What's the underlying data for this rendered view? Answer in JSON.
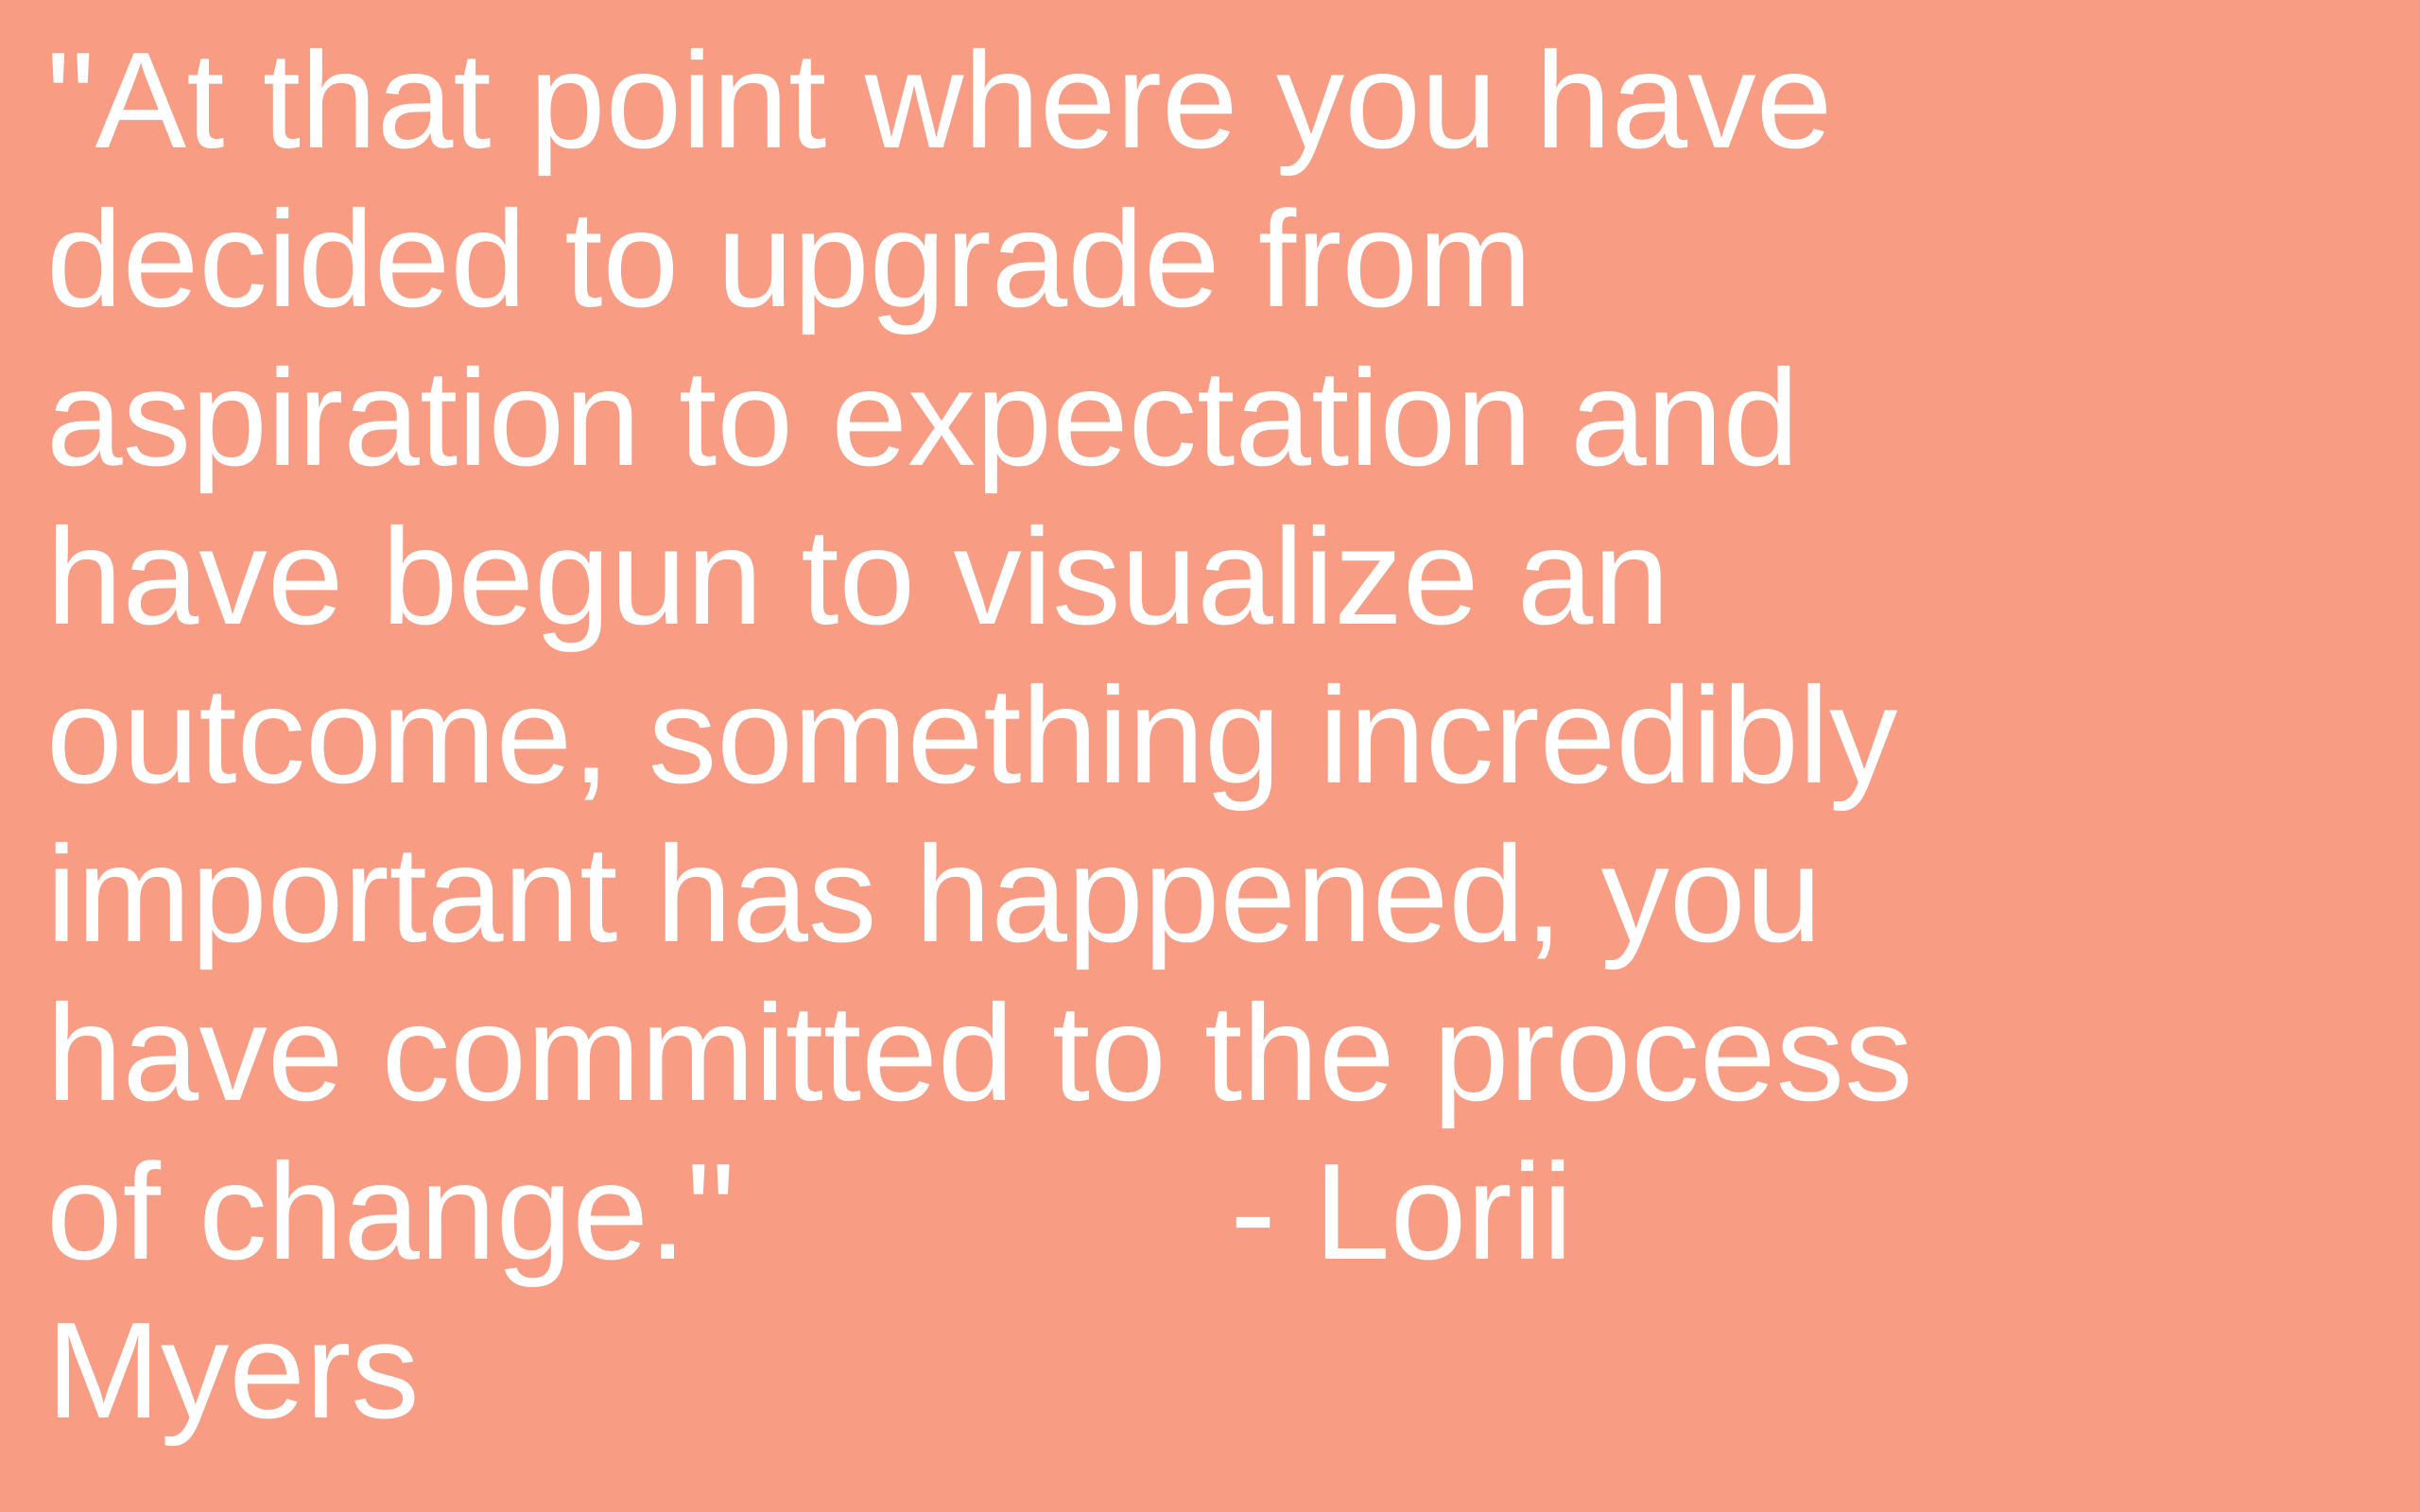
{
  "background_color": "#F89C83",
  "text_color": "#FFFFFF",
  "quote": {
    "lines": [
      "\"At that point where you have",
      "decided to upgrade from",
      "aspiration to expectation and",
      "have begun to visualize an",
      "outcome, something incredibly",
      "important has happened, you",
      "have committed to the process",
      "of change.\"             - Lorii",
      "Myers"
    ]
  }
}
